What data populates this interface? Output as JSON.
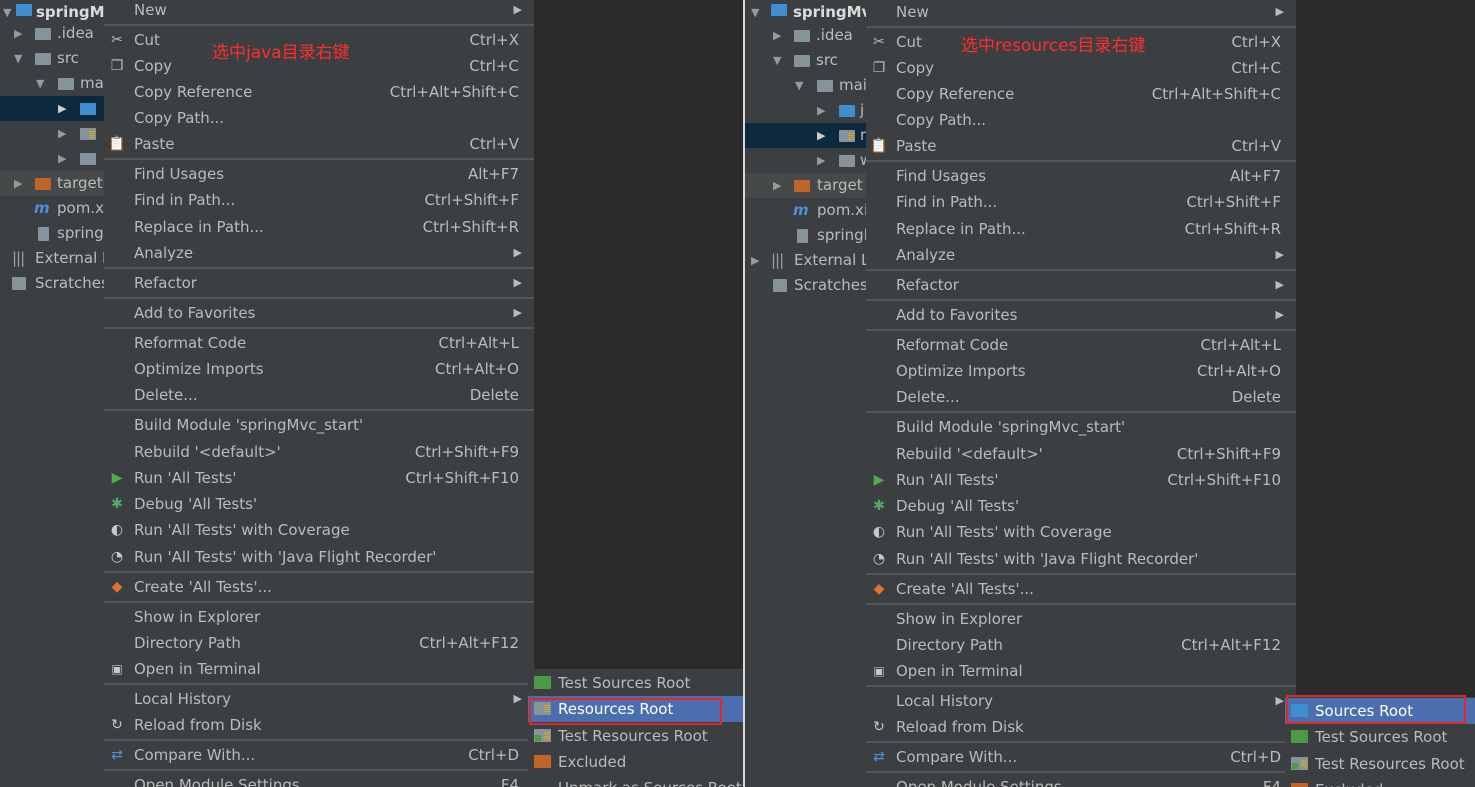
{
  "colors": {
    "tree_bg": "#3c3f41",
    "editor_bg": "#2b2b2b",
    "menu_bg": "#3c3f41",
    "separator": "#515658",
    "highlight": "#4b6eaf",
    "annotation": "#ff2d2d",
    "red_box": "#e02828",
    "source_folder": "#3d8fd1",
    "test_folder": "#4c9a44",
    "excluded_folder": "#c0642a"
  },
  "left": {
    "tree": {
      "root": "springMv",
      "idea": ".idea",
      "src": "src",
      "main": "ma",
      "target": "target",
      "pom": "pom.x",
      "iml": "spring",
      "external": "External L",
      "scratches": "Scratches"
    },
    "annotation": "选中java目录右键",
    "submenu": [
      "Test Sources Root",
      "Resources Root",
      "Test Resources Root",
      "Excluded",
      "Unmark as Sources Root"
    ]
  },
  "right": {
    "tree": {
      "root": "springMv",
      "idea": ".idea",
      "src": "src",
      "main": "mai",
      "java_trunc": "j",
      "res_trunc": "r",
      "web_trunc": "w",
      "target": "target",
      "pom": "pom.xi",
      "iml": "springl",
      "external": "External Li",
      "scratches": "Scratches"
    },
    "annotation": "选中resources目录右键",
    "submenu": [
      "Sources Root",
      "Test Sources Root",
      "Test Resources Root",
      "Excluded"
    ]
  },
  "menu": {
    "new": "New",
    "cut": "Cut",
    "cut_sc": "Ctrl+X",
    "copy": "Copy",
    "copy_sc": "Ctrl+C",
    "copy_ref": "Copy Reference",
    "copy_ref_sc": "Ctrl+Alt+Shift+C",
    "copy_path": "Copy Path...",
    "paste": "Paste",
    "paste_sc": "Ctrl+V",
    "find_usages": "Find Usages",
    "find_usages_sc": "Alt+F7",
    "find_in_path": "Find in Path...",
    "find_in_path_sc": "Ctrl+Shift+F",
    "replace_in_path": "Replace in Path...",
    "replace_in_path_sc": "Ctrl+Shift+R",
    "analyze": "Analyze",
    "refactor": "Refactor",
    "add_fav": "Add to Favorites",
    "reformat": "Reformat Code",
    "reformat_sc": "Ctrl+Alt+L",
    "optimize": "Optimize Imports",
    "optimize_sc": "Ctrl+Alt+O",
    "delete": "Delete...",
    "delete_sc": "Delete",
    "build": "Build Module 'springMvc_start'",
    "rebuild": "Rebuild '<default>'",
    "rebuild_sc": "Ctrl+Shift+F9",
    "run": "Run 'All Tests'",
    "run_sc": "Ctrl+Shift+F10",
    "debug": "Debug 'All Tests'",
    "coverage": "Run 'All Tests' with Coverage",
    "jfr": "Run 'All Tests' with 'Java Flight Recorder'",
    "create": "Create 'All Tests'...",
    "explorer": "Show in Explorer",
    "dir_path": "Directory Path",
    "dir_path_sc": "Ctrl+Alt+F12",
    "terminal": "Open in Terminal",
    "local_history": "Local History",
    "reload": "Reload from Disk",
    "compare": "Compare With...",
    "compare_sc": "Ctrl+D",
    "module_settings": "Open Module Settings",
    "module_settings_sc": "F4"
  }
}
